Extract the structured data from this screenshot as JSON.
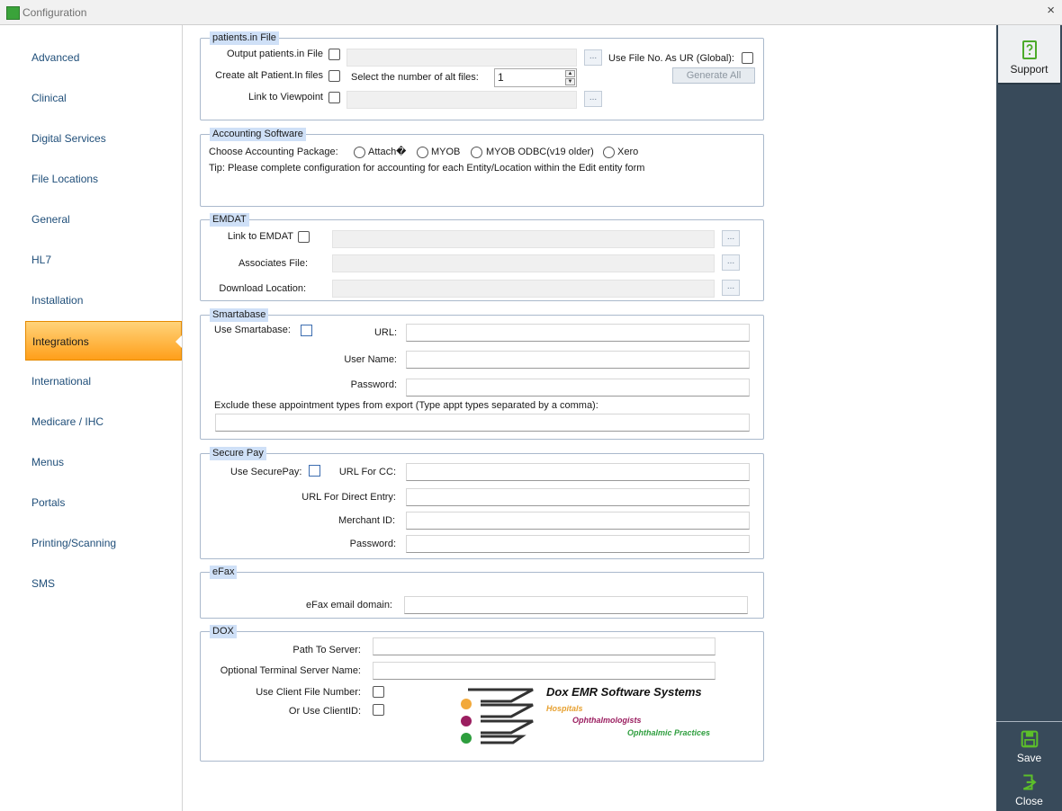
{
  "window": {
    "title": "Configuration",
    "close_label": "×"
  },
  "sidebar": {
    "items": [
      {
        "label": "Advanced"
      },
      {
        "label": "Clinical"
      },
      {
        "label": "Digital Services"
      },
      {
        "label": "File Locations"
      },
      {
        "label": "General"
      },
      {
        "label": "HL7"
      },
      {
        "label": "Installation"
      },
      {
        "label": "Integrations",
        "active": true
      },
      {
        "label": "International"
      },
      {
        "label": "Medicare / IHC"
      },
      {
        "label": "Menus"
      },
      {
        "label": "Portals"
      },
      {
        "label": "Printing/Scanning"
      },
      {
        "label": "SMS"
      }
    ]
  },
  "rightbar": {
    "support": "Support",
    "save": "Save",
    "close": "Close"
  },
  "patients": {
    "legend": "patients.in File",
    "output_label": "Output patients.in File",
    "alt_label": "Create alt Patient.In files",
    "viewpoint_label": "Link to Viewpoint",
    "select_alt_label": "Select the number of alt files:",
    "alt_count": "1",
    "use_file_no_label": "Use File No. As UR (Global):",
    "generate_all": "Generate All",
    "browse": "..."
  },
  "accounting": {
    "legend": "Accounting Software",
    "choose_label": "Choose Accounting Package:",
    "options": [
      "Attach�",
      "MYOB",
      "MYOB ODBC(v19 older)",
      "Xero"
    ],
    "tip": "Tip: Please complete configuration for accounting for each Entity/Location within the Edit entity form"
  },
  "emdat": {
    "legend": "EMDAT",
    "link_label": "Link to EMDAT",
    "associates_label": "Associates File:",
    "download_label": "Download Location:"
  },
  "smartabase": {
    "legend": "Smartabase",
    "use_label": "Use Smartabase:",
    "url_label": "URL:",
    "user_label": "User Name:",
    "password_label": "Password:",
    "exclude_label": "Exclude these appointment types from export (Type appt types separated by a comma):"
  },
  "securepay": {
    "legend": "Secure Pay",
    "use_label": "Use SecurePay:",
    "url_cc_label": "URL For CC:",
    "url_direct_label": "URL For Direct Entry:",
    "merchant_label": "Merchant ID:",
    "password_label": "Password:"
  },
  "efax": {
    "legend": "eFax",
    "domain_label": "eFax email domain:"
  },
  "dox": {
    "legend": "DOX",
    "path_label": "Path To Server:",
    "terminal_label": "Optional Terminal Server Name:",
    "client_file_label": "Use Client File Number:",
    "client_id_label": "Or Use ClientID:",
    "logo": {
      "company": "Dox EMR Software Systems",
      "line1": "Hospitals",
      "line2": "Ophthalmologists",
      "line3": "Ophthalmic Practices"
    }
  },
  "colors": {
    "accent": "#ff9f1a",
    "sidebar_link": "#1f4e79",
    "rightbar": "#384a5a",
    "icon_green": "#5cbf2a"
  }
}
